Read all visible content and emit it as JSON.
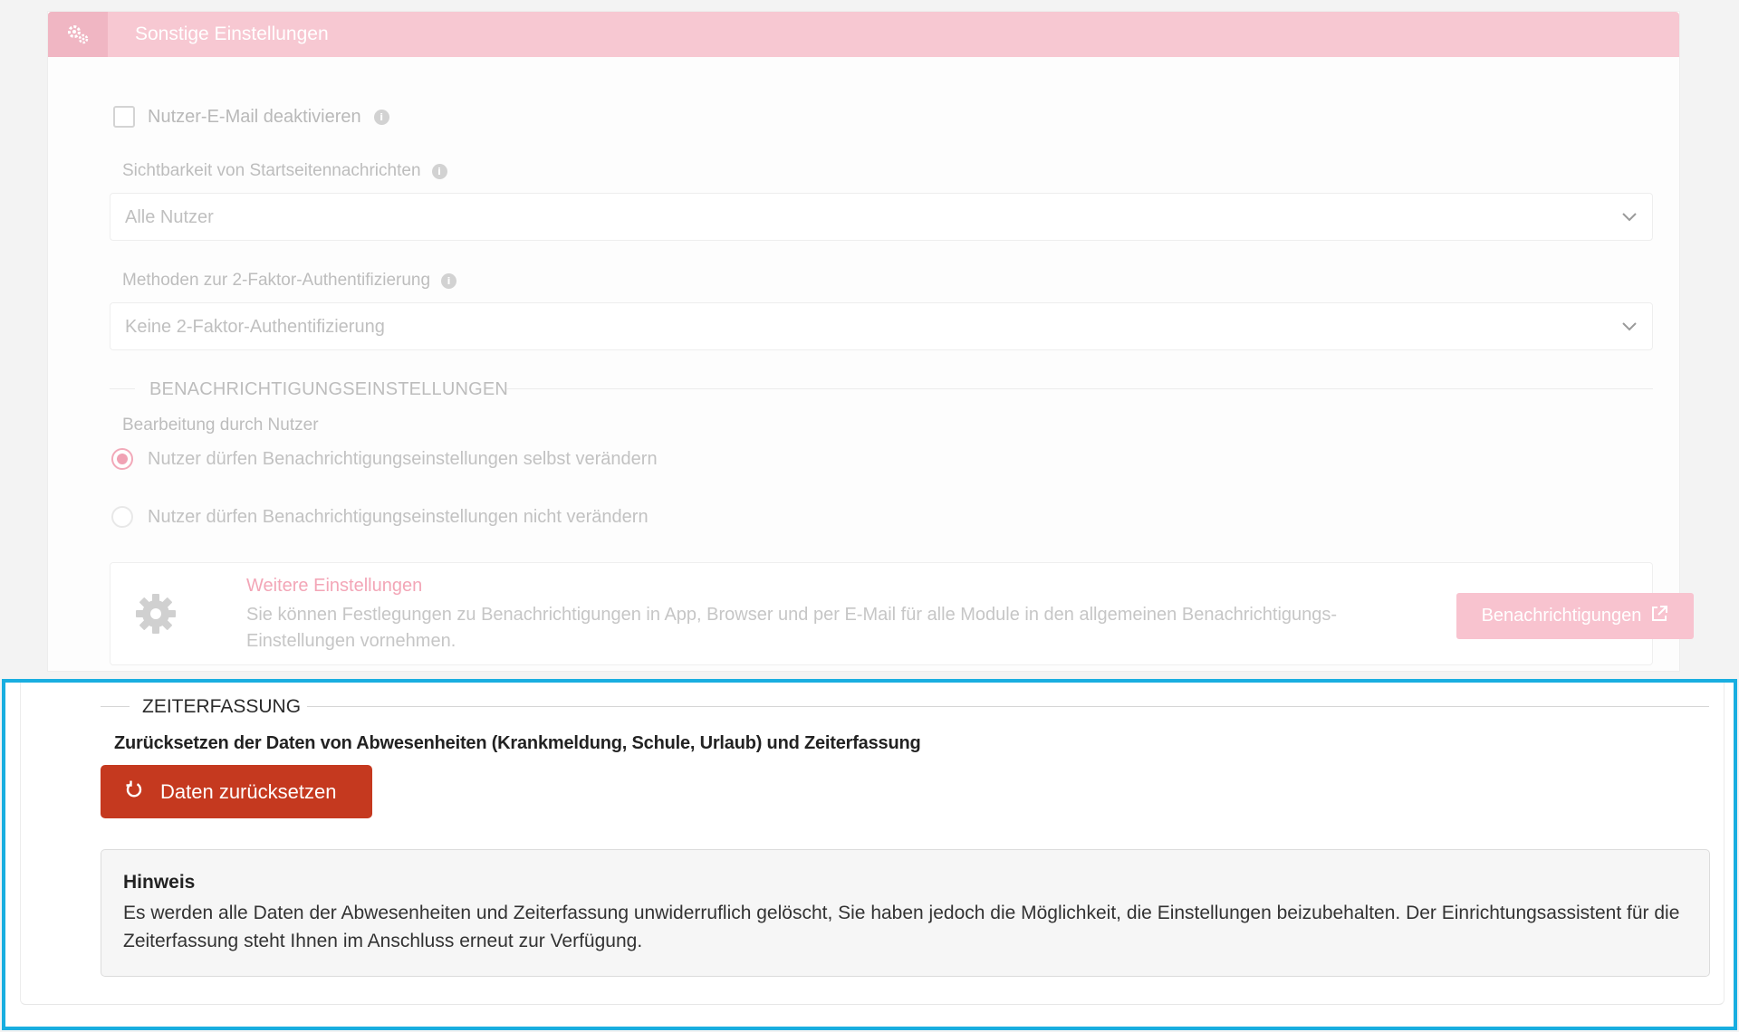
{
  "other_settings": {
    "title": "Sonstige Einstellungen",
    "disable_user_email_label": "Nutzer-E-Mail deaktivieren",
    "homepage_news_visibility_label": "Sichtbarkeit von Startseitennachrichten",
    "homepage_news_visibility_value": "Alle Nutzer",
    "two_factor_label": "Methoden zur 2-Faktor-Authentifizierung",
    "two_factor_value": "Keine 2-Faktor-Authentifizierung"
  },
  "notification_settings": {
    "section_title": "BENACHRICHTIGUNGSEINSTELLUNGEN",
    "editing_label": "Bearbeitung durch Nutzer",
    "option_allow": "Nutzer dürfen Benachrichtigungseinstellungen selbst verändern",
    "option_deny": "Nutzer dürfen Benachrichtigungseinstellungen nicht verändern",
    "selected_option": "option_allow",
    "more_title": "Weitere Einstellungen",
    "more_desc": "Sie können Festlegungen zu Benachrichtigungen in App, Browser und per E-Mail für alle Module in den allgemeinen Benachrichtigungs-Einstellungen vornehmen.",
    "notify_button": "Benachrichtigungen"
  },
  "time_tracking": {
    "section_title": "ZEITERFASSUNG",
    "reset_description": "Zurücksetzen der Daten von Abwesenheiten (Krankmeldung, Schule, Urlaub) und Zeiterfassung",
    "reset_button": "Daten zurücksetzen",
    "hint_title": "Hinweis",
    "hint_text": "Es werden alle Daten der Abwesenheiten und Zeiterfassung unwiderruflich gelöscht, Sie haben jedoch die Möglichkeit, die Einstellungen beizubehalten. Der Einrichtungsassistent für die Zeiterfassung steht Ihnen im Anschluss erneut zur Verfügung."
  },
  "colors": {
    "highlight_border": "#19aee0",
    "reset_button": "#c5391f",
    "header_pink": "#f7c8d2"
  },
  "icons": {
    "header": "gears-icon",
    "info": "info-icon",
    "chevron": "chevron-down-icon",
    "gear": "gear-icon",
    "external_link": "external-link-icon",
    "reset": "refresh-icon"
  }
}
